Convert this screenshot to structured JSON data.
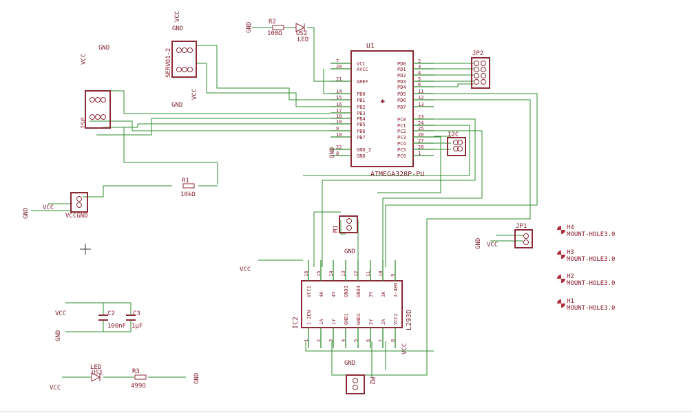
{
  "u1": {
    "name": "U1",
    "part": "ATMEGA328P-PU",
    "left_pins": [
      "VCC",
      "AVCC",
      "AREF",
      "PB0",
      "PB1",
      "PB2",
      "PB3",
      "PB4",
      "PB5",
      "PB6",
      "PB7",
      "GND_2",
      "GND"
    ],
    "right_pins": [
      "PD0",
      "PD1",
      "PD2",
      "PD3",
      "PD4",
      "PD5",
      "PD6",
      "PD7",
      "PC0",
      "PC1",
      "PC2",
      "PC3",
      "PC4",
      "PC5",
      "PC6"
    ],
    "right_pin_numbers": [
      "2",
      "3",
      "4",
      "5",
      "6",
      "11",
      "12",
      "13",
      "23",
      "24",
      "25",
      "26",
      "27",
      "28",
      "1"
    ],
    "left_pin_numbers": [
      "7",
      "20",
      "21",
      "14",
      "15",
      "16",
      "17",
      "18",
      "19",
      "9",
      "10",
      "22",
      "8"
    ]
  },
  "ic2": {
    "name": "IC2",
    "part": "L293D",
    "top_pins": [
      "VCC1",
      "4A",
      "4Y",
      "GND3",
      "GND4",
      "3Y",
      "3A",
      "3-4EN"
    ],
    "top_pin_numbers": [
      "16",
      "15",
      "14",
      "13",
      "12",
      "11",
      "10",
      "9"
    ],
    "bottom_pins": [
      "1-2EN",
      "1A",
      "1Y",
      "GND1",
      "GND2",
      "2Y",
      "2A",
      "VCC2"
    ],
    "bottom_pin_numbers": [
      "1",
      "2",
      "3",
      "4",
      "5",
      "6",
      "7",
      "8"
    ]
  },
  "r1": {
    "name": "R1",
    "value": "10kΩ"
  },
  "r2": {
    "name": "R2",
    "value": "100Ω"
  },
  "r3": {
    "name": "R3",
    "value": "499Ω"
  },
  "c2": {
    "name": "C2",
    "value": "100nF"
  },
  "c3": {
    "name": "C3",
    "value": "1µF"
  },
  "us1": {
    "name": "US1",
    "part": "LED"
  },
  "us2": {
    "name": "US2",
    "part": "LED"
  },
  "headers": {
    "isp": "ISP",
    "servo": "SERVO1-2",
    "jp2": "JP2",
    "i2c": "I2C",
    "vccgnd": "VCCGND",
    "m1": "M1",
    "m2": "M2",
    "jp1": "JP1"
  },
  "mount_holes": [
    {
      "name": "H4",
      "part": "MOUNT-HOLE3.0"
    },
    {
      "name": "H3",
      "part": "MOUNT-HOLE3.0"
    },
    {
      "name": "H2",
      "part": "MOUNT-HOLE3.0"
    },
    {
      "name": "H1",
      "part": "MOUNT-HOLE3.0"
    }
  ],
  "nets": {
    "vcc": "VCC",
    "gnd": "GND"
  }
}
